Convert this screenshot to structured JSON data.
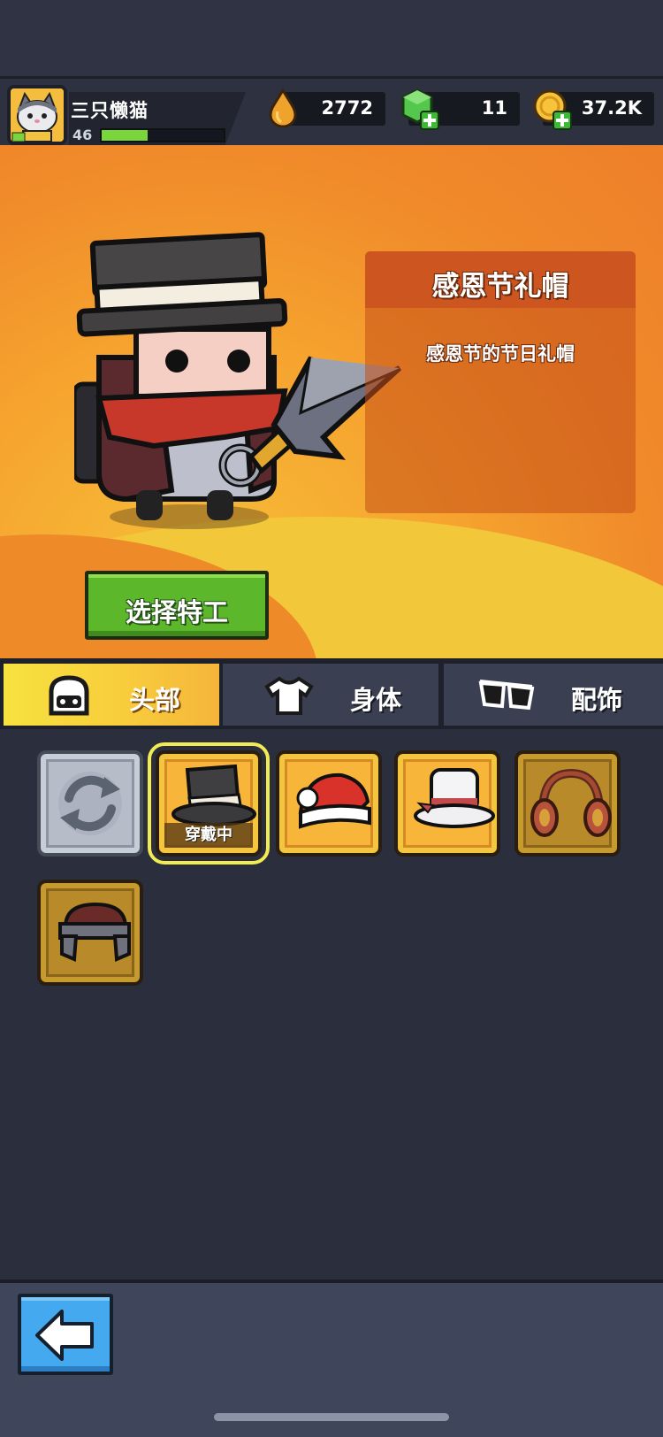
{
  "player": {
    "name": "三只懒猫",
    "level": "46",
    "xp_fraction": 0.38
  },
  "currencies": [
    {
      "name": "oil-drop",
      "icon": "oil-drop-icon",
      "value": "2772"
    },
    {
      "name": "gem",
      "icon": "green-gem-plus-icon",
      "value": "11"
    },
    {
      "name": "coin",
      "icon": "gold-coin-plus-icon",
      "value": "37.2K"
    }
  ],
  "item_detail": {
    "title": "感恩节礼帽",
    "description": "感恩节的节日礼帽"
  },
  "select_agent_button": "选择特工",
  "tabs": [
    {
      "label": "头部",
      "icon": "helmet-icon",
      "active": true
    },
    {
      "label": "身体",
      "icon": "shirt-icon",
      "active": false
    },
    {
      "label": "配饰",
      "icon": "glasses-icon",
      "active": false
    }
  ],
  "items": [
    {
      "name": "refresh",
      "icon": "refresh-icon"
    },
    {
      "name": "top-hat",
      "icon": "top-hat-icon",
      "tag": "穿戴中"
    },
    {
      "name": "santa-hat",
      "icon": "santa-hat-icon"
    },
    {
      "name": "white-top-hat",
      "icon": "white-top-hat-icon"
    },
    {
      "name": "headphones",
      "icon": "headphones-icon"
    },
    {
      "name": "ushanka-hat",
      "icon": "ushanka-hat-icon"
    }
  ],
  "colors": {
    "accent_green": "#5cb82a",
    "active_tab": "#f7e23f",
    "hero_orange": "#f08a2a",
    "back_blue": "#44a9ef"
  }
}
